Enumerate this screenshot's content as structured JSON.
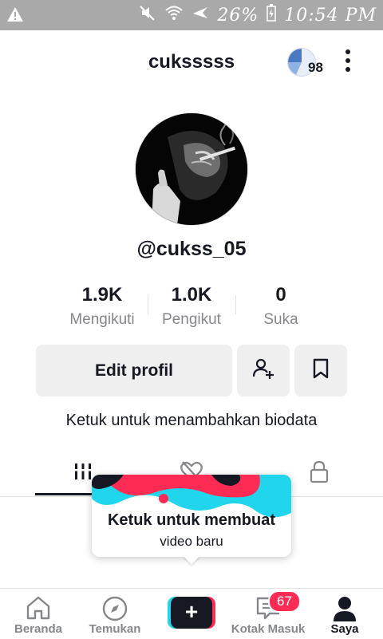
{
  "status_bar": {
    "battery_percent": "26%",
    "time": "10:54 PM",
    "icons": [
      "warning-icon",
      "mute-icon",
      "wifi-icon",
      "airplane-icon",
      "battery-charging-icon"
    ]
  },
  "header": {
    "username": "cuksssss",
    "coin_count": "98"
  },
  "profile": {
    "handle": "@cukss_05",
    "stats": [
      {
        "value": "1.9K",
        "label": "Mengikuti"
      },
      {
        "value": "1.0K",
        "label": "Pengikut"
      },
      {
        "value": "0",
        "label": "Suka"
      }
    ],
    "edit_button": "Edit profil",
    "bio_prompt": "Ketuk untuk menambahkan biodata"
  },
  "tabs": [
    {
      "name": "videos",
      "icon": "grid-icon",
      "active": true
    },
    {
      "name": "liked",
      "icon": "hidden-heart-icon",
      "active": false
    },
    {
      "name": "private",
      "icon": "lock-icon",
      "active": false
    }
  ],
  "tooltip": {
    "title": "Ketuk untuk membuat",
    "subtitle": "video baru"
  },
  "bottom_nav": {
    "items": [
      {
        "label": "Beranda",
        "icon": "home-icon"
      },
      {
        "label": "Temukan",
        "icon": "compass-icon"
      },
      {
        "label": "",
        "icon": "create-plus-icon"
      },
      {
        "label": "Kotak Masuk",
        "icon": "inbox-icon",
        "badge": "67"
      },
      {
        "label": "Saya",
        "icon": "profile-icon",
        "active": true
      }
    ]
  },
  "colors": {
    "accent_pink": "#fe2c55",
    "accent_cyan": "#20d5ec",
    "text_primary": "#161823",
    "text_secondary": "#86878b",
    "status_bar_bg": "#a9a9a9"
  }
}
